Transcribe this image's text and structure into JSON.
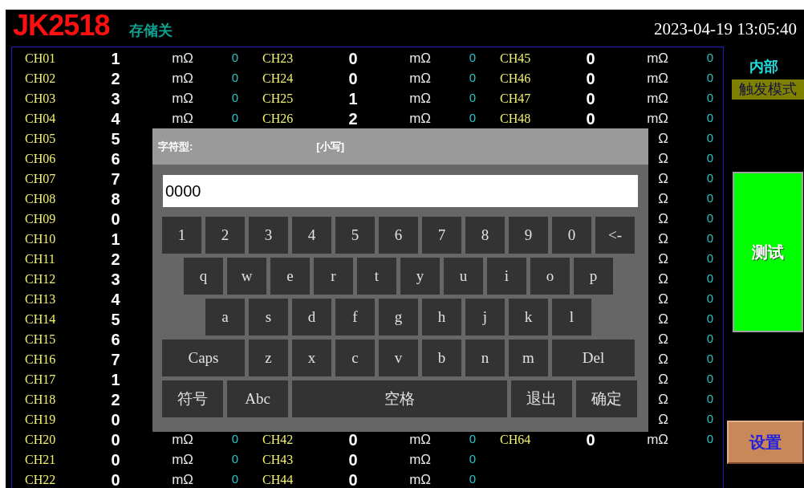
{
  "header": {
    "model": "JK2518",
    "storage": "存储关",
    "datetime": "2023-04-19 13:05:40"
  },
  "table": {
    "rows": [
      {
        "group_1": {
          "channel": "CH01",
          "value": "1",
          "unit": "mΩ",
          "status": "0"
        },
        "group_2": {
          "channel": "CH23",
          "value": "0",
          "unit": "mΩ",
          "status": "0"
        },
        "group_3": {
          "channel": "CH45",
          "value": "0",
          "unit": "mΩ",
          "status": "0"
        }
      },
      {
        "group_1": {
          "channel": "CH02",
          "value": "2",
          "unit": "mΩ",
          "status": "0"
        },
        "group_2": {
          "channel": "CH24",
          "value": "0",
          "unit": "mΩ",
          "status": "0"
        },
        "group_3": {
          "channel": "CH46",
          "value": "0",
          "unit": "mΩ",
          "status": "0"
        }
      },
      {
        "group_1": {
          "channel": "CH03",
          "value": "3",
          "unit": "mΩ",
          "status": "0"
        },
        "group_2": {
          "channel": "CH25",
          "value": "1",
          "unit": "mΩ",
          "status": "0"
        },
        "group_3": {
          "channel": "CH47",
          "value": "0",
          "unit": "mΩ",
          "status": "0"
        }
      },
      {
        "group_1": {
          "channel": "CH04",
          "value": "4",
          "unit": "mΩ",
          "status": "0"
        },
        "group_2": {
          "channel": "CH26",
          "value": "2",
          "unit": "mΩ",
          "status": "0"
        },
        "group_3": {
          "channel": "CH48",
          "value": "0",
          "unit": "mΩ",
          "status": "0"
        }
      },
      {
        "group_1": {
          "channel": "CH05",
          "value": "5"
        },
        "group_3": {
          "unit": "Ω",
          "status": "0"
        }
      },
      {
        "group_1": {
          "channel": "CH06",
          "value": "6"
        },
        "group_3": {
          "unit": "Ω",
          "status": "0"
        }
      },
      {
        "group_1": {
          "channel": "CH07",
          "value": "7"
        },
        "group_3": {
          "unit": "Ω",
          "status": "0"
        }
      },
      {
        "group_1": {
          "channel": "CH08",
          "value": "8"
        },
        "group_3": {
          "unit": "Ω",
          "status": "0"
        }
      },
      {
        "group_1": {
          "channel": "CH09",
          "value": "0"
        },
        "group_3": {
          "unit": "Ω",
          "status": "0"
        }
      },
      {
        "group_1": {
          "channel": "CH10",
          "value": "1"
        },
        "group_3": {
          "unit": "Ω",
          "status": "0"
        }
      },
      {
        "group_1": {
          "channel": "CH11",
          "value": "2"
        },
        "group_3": {
          "unit": "Ω",
          "status": "0"
        }
      },
      {
        "group_1": {
          "channel": "CH12",
          "value": "3"
        },
        "group_3": {
          "unit": "Ω",
          "status": "0"
        }
      },
      {
        "group_1": {
          "channel": "CH13",
          "value": "4"
        },
        "group_3": {
          "unit": "Ω",
          "status": "0"
        }
      },
      {
        "group_1": {
          "channel": "CH14",
          "value": "5"
        },
        "group_3": {
          "unit": "Ω",
          "status": "0"
        }
      },
      {
        "group_1": {
          "channel": "CH15",
          "value": "6"
        },
        "group_3": {
          "unit": "Ω",
          "status": "0"
        }
      },
      {
        "group_1": {
          "channel": "CH16",
          "value": "7"
        },
        "group_3": {
          "unit": "Ω",
          "status": "0"
        }
      },
      {
        "group_1": {
          "channel": "CH17",
          "value": "1"
        },
        "group_3": {
          "unit": "Ω",
          "status": "0"
        }
      },
      {
        "group_1": {
          "channel": "CH18",
          "value": "2"
        },
        "group_3": {
          "unit": "Ω",
          "status": "0"
        }
      },
      {
        "group_1": {
          "channel": "CH19",
          "value": "0"
        },
        "group_3": {
          "unit": "Ω",
          "status": "0"
        }
      },
      {
        "group_1": {
          "channel": "CH20",
          "value": "0",
          "unit": "mΩ",
          "status": "0"
        },
        "group_2": {
          "channel": "CH42",
          "value": "0",
          "unit": "mΩ",
          "status": "0"
        },
        "group_3": {
          "channel": "CH64",
          "value": "0",
          "unit": "mΩ",
          "status": "0"
        }
      },
      {
        "group_1": {
          "channel": "CH21",
          "value": "0",
          "unit": "mΩ",
          "status": "0"
        },
        "group_2": {
          "channel": "CH43",
          "value": "0",
          "unit": "mΩ",
          "status": "0"
        }
      },
      {
        "group_1": {
          "channel": "CH22",
          "value": "0",
          "unit": "mΩ",
          "status": "0"
        },
        "group_2": {
          "channel": "CH44",
          "value": "0",
          "unit": "mΩ",
          "status": "0"
        }
      }
    ]
  },
  "side_panel": {
    "source": "内部",
    "trigger_mode": "触发模式",
    "test_button": "测试",
    "settings_button": "设置"
  },
  "keyboard_dialog": {
    "title": "字符型:",
    "case_mode": "[小写]",
    "input_value": "0000",
    "key_rows": [
      {
        "keys": [
          {
            "label": "1",
            "kind": "key"
          },
          {
            "label": "2",
            "kind": "key"
          },
          {
            "label": "3",
            "kind": "key"
          },
          {
            "label": "4",
            "kind": "key"
          },
          {
            "label": "5",
            "kind": "key"
          },
          {
            "label": "6",
            "kind": "key"
          },
          {
            "label": "7",
            "kind": "key"
          },
          {
            "label": "8",
            "kind": "key"
          },
          {
            "label": "9",
            "kind": "key"
          },
          {
            "label": "0",
            "kind": "key"
          },
          {
            "label": "<-",
            "kind": "key"
          }
        ]
      },
      {
        "keys": [
          {
            "label": "q",
            "kind": "key"
          },
          {
            "label": "w",
            "kind": "key"
          },
          {
            "label": "e",
            "kind": "key"
          },
          {
            "label": "r",
            "kind": "key"
          },
          {
            "label": "t",
            "kind": "key"
          },
          {
            "label": "y",
            "kind": "key"
          },
          {
            "label": "u",
            "kind": "key"
          },
          {
            "label": "i",
            "kind": "key"
          },
          {
            "label": "o",
            "kind": "key"
          },
          {
            "label": "p",
            "kind": "key"
          }
        ]
      },
      {
        "keys": [
          {
            "label": "a",
            "kind": "key"
          },
          {
            "label": "s",
            "kind": "key"
          },
          {
            "label": "d",
            "kind": "key"
          },
          {
            "label": "f",
            "kind": "key"
          },
          {
            "label": "g",
            "kind": "key"
          },
          {
            "label": "h",
            "kind": "key"
          },
          {
            "label": "j",
            "kind": "key"
          },
          {
            "label": "k",
            "kind": "key"
          },
          {
            "label": "l",
            "kind": "key"
          }
        ]
      },
      {
        "keys": [
          {
            "label": "Caps",
            "kind": "wide"
          },
          {
            "label": "z",
            "kind": "key"
          },
          {
            "label": "x",
            "kind": "key"
          },
          {
            "label": "c",
            "kind": "key"
          },
          {
            "label": "v",
            "kind": "key"
          },
          {
            "label": "b",
            "kind": "key"
          },
          {
            "label": "n",
            "kind": "key"
          },
          {
            "label": "m",
            "kind": "key"
          },
          {
            "label": "Del",
            "kind": "wide"
          }
        ]
      },
      {
        "keys": [
          {
            "label": "符号",
            "kind": "action"
          },
          {
            "label": "Abc",
            "kind": "action"
          },
          {
            "label": "空格",
            "kind": "space"
          },
          {
            "label": "退出",
            "kind": "action"
          },
          {
            "label": "确定",
            "kind": "action"
          }
        ]
      }
    ]
  }
}
